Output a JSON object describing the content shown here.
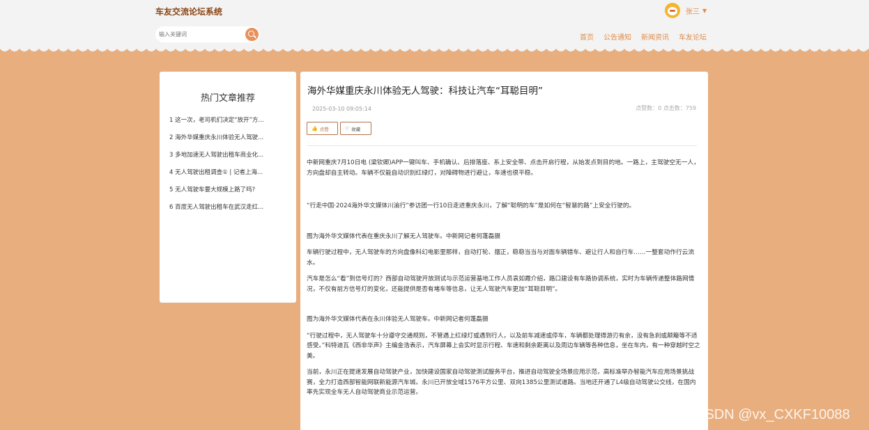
{
  "header": {
    "brand": "车友交流论坛系统",
    "user_name": "张三",
    "search_placeholder": "输入关键词",
    "nav": [
      "首页",
      "公告通知",
      "新闻资讯",
      "车友论坛"
    ]
  },
  "sidebar": {
    "title": "热门文章推荐",
    "items": [
      "1 这一次，老司机们决定“放开”方...",
      "2 海外华媒重庆永川体验无人驾驶...",
      "3 多地加速无人驾驶出租车商业化...",
      "4 无人驾驶出租调查① | 记者上海...",
      "5 无人驾驶车要大规模上路了吗?",
      "6 百度无人驾驶出租车在武汉走红..."
    ]
  },
  "article": {
    "title": "海外华媒重庆永川体验无人驾驶：科技让汽车“耳聪目明”",
    "date": "2025-03-10 09:05:14",
    "stats": "点赞数：0    点击数：759",
    "like_label": "点赞",
    "fav_label": "收藏",
    "paragraphs": [
      "中新网重庆7月10日电 (梁钦卿)APP一键叫车、手机确认、后排落座、系上安全带、点击开启行程，从始发点到目的地。一路上，主驾驶空无一人，方向盘却自主转动。车辆不仅能自动识别红绿灯，对障碍物进行避让，车速也很平稳。",
      "",
      "“行走中国·2024海外华文媒体川渝行”参访团一行10日走进重庆永川，了解“聪明的车”是如何在“智慧的路”上安全行驶的。",
      "",
      "图为海外华文媒体代表在重庆永川了解无人驾驶车。中新网记者何蓬磊摄",
      "车辆行驶过程中，无人驾驶车的方向盘像科幻电影里那样，自动打轮、摆正，稳稳当当与对面车辆错车、避让行人和自行车……一整套动作行云流水。",
      "汽车是怎么“看”到信号灯的？西部自动驾驶开放测试与示范运营基地工作人员袁如霞介绍，路口建设有车路协调系统，实时为车辆传递整体路网情况，不仅有前方信号灯的变化，还能提供是否有堵车等信息，让无人驾驶汽车更加“耳聪目明”。",
      "",
      "图为海外华文媒体代表在永川体验无人驾驶车。中新网记者何蓬磊摄",
      "“行驶过程中，无人驾驶车十分遵守交通规则，不管遇上红绿灯或遇到行人，以及前车减速或停车，车辆都处理得游刃有余，没有急刹或颠簸等不适感受。”科特迪瓦《西非华声》主编金浩表示，汽车屏幕上会实时显示行程、车速和剩余距离以及周边车辆等各种信息，坐在车内，有一种穿越时空之美。",
      "当前，永川正在提速发展自动驾驶产业，加快建设国家自动驾驶测试服务平台，推进自动驾驶全场景应用示范，高标准举办智能汽车应用场景挑战赛，全力打造西部智能网联新能源汽车城。永川已开放全域1576平方公里、双向1385公里测试道路。当地还开通了L4级自动驾驶公交线，在国内率先实现全车无人自动驾驶商业示范运营。"
    ]
  },
  "watermark": "CSDN @vx_CXKF10088",
  "colors": {
    "accent": "#e08c4a",
    "background": "#e8ae7e",
    "header": "#f3f3f3"
  }
}
